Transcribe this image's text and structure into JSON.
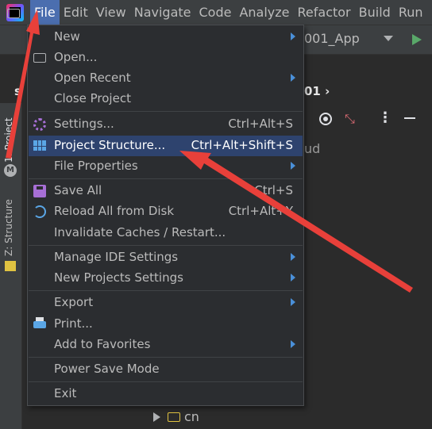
{
  "menubar": {
    "items": [
      {
        "label": "File",
        "active": true
      },
      {
        "label": "Edit"
      },
      {
        "label": "View"
      },
      {
        "label": "Navigate"
      },
      {
        "label": "Code"
      },
      {
        "label": "Analyze"
      },
      {
        "label": "Refactor"
      },
      {
        "label": "Build"
      },
      {
        "label": "Run"
      }
    ]
  },
  "toolbar": {
    "run_config": "001_App"
  },
  "breadcrumb": {
    "left": "s",
    "right": "01 ›"
  },
  "project_panel": {
    "side_text": "ud"
  },
  "tool_strip": {
    "project_tab": "1: Project",
    "structure_tab": "Z: Structure"
  },
  "tree": {
    "item_label": "cn"
  },
  "file_menu": {
    "items": [
      {
        "label": "New",
        "submenu": true
      },
      {
        "label": "Open...",
        "icon": "folder-open-icon"
      },
      {
        "label": "Open Recent",
        "submenu": true
      },
      {
        "label": "Close Project"
      },
      {
        "label": "Settings...",
        "shortcut": "Ctrl+Alt+S",
        "icon": "gear-icon"
      },
      {
        "label": "Project Structure...",
        "shortcut": "Ctrl+Alt+Shift+S",
        "icon": "project-structure-icon",
        "highlighted": true
      },
      {
        "label": "File Properties",
        "submenu": true
      },
      {
        "label": "Save All",
        "shortcut": "Ctrl+S",
        "icon": "save-icon"
      },
      {
        "label": "Reload All from Disk",
        "shortcut": "Ctrl+Alt+Y",
        "icon": "reload-icon"
      },
      {
        "label": "Invalidate Caches / Restart..."
      },
      {
        "label": "Manage IDE Settings",
        "submenu": true
      },
      {
        "label": "New Projects Settings",
        "submenu": true
      },
      {
        "label": "Export",
        "submenu": true
      },
      {
        "label": "Print...",
        "icon": "print-icon"
      },
      {
        "label": "Add to Favorites",
        "submenu": true
      },
      {
        "label": "Power Save Mode"
      },
      {
        "label": "Exit"
      }
    ]
  },
  "colors": {
    "annotation_arrow": "#e8403a",
    "highlight": "#2e436e",
    "menu_bg": "#2b2d30"
  }
}
